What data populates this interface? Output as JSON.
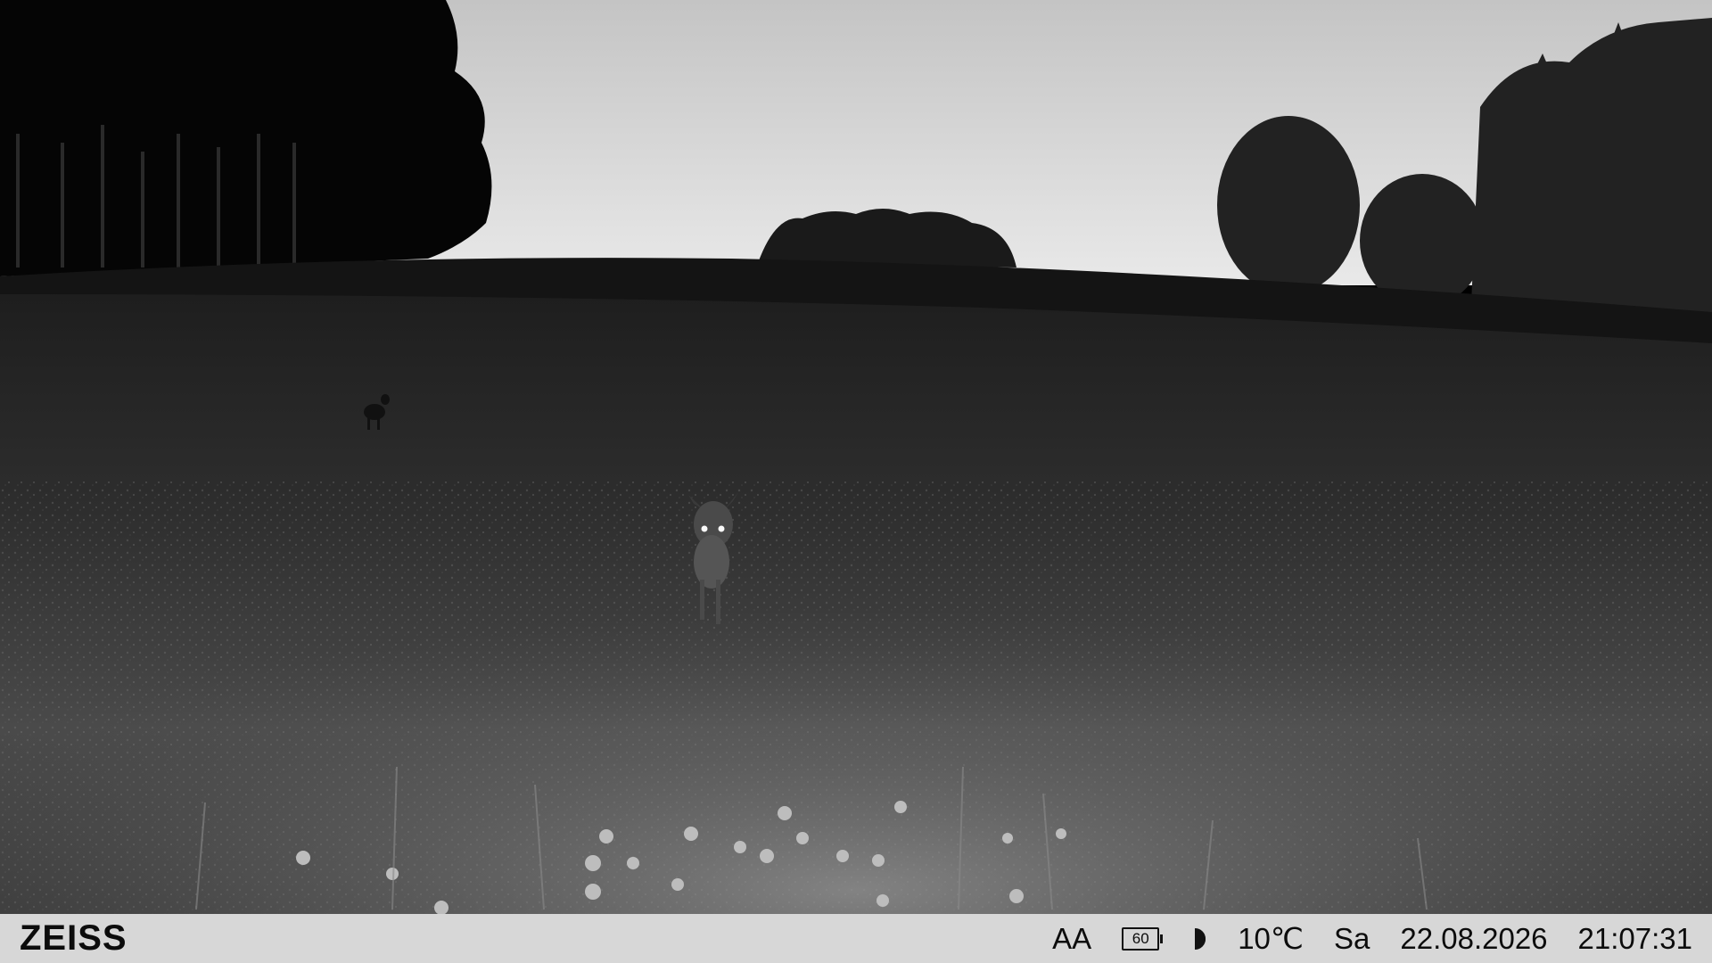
{
  "scene": {
    "description_icon": "trail-camera-night-infrared"
  },
  "info_bar": {
    "brand": "ZEISS",
    "mode": "AA",
    "battery": "60",
    "moon_icon": "moon-phase-icon",
    "temperature": "10℃",
    "weekday": "Sa",
    "date": "22.08.2026",
    "time": "21:07:31"
  },
  "colors": {
    "sky_top": "#c9c9c9",
    "sky_bottom": "#e6e6e6",
    "meadow_far": "#2a2a2a",
    "meadow_near": "#6a6a6a",
    "bar": "#d7d7d7"
  }
}
